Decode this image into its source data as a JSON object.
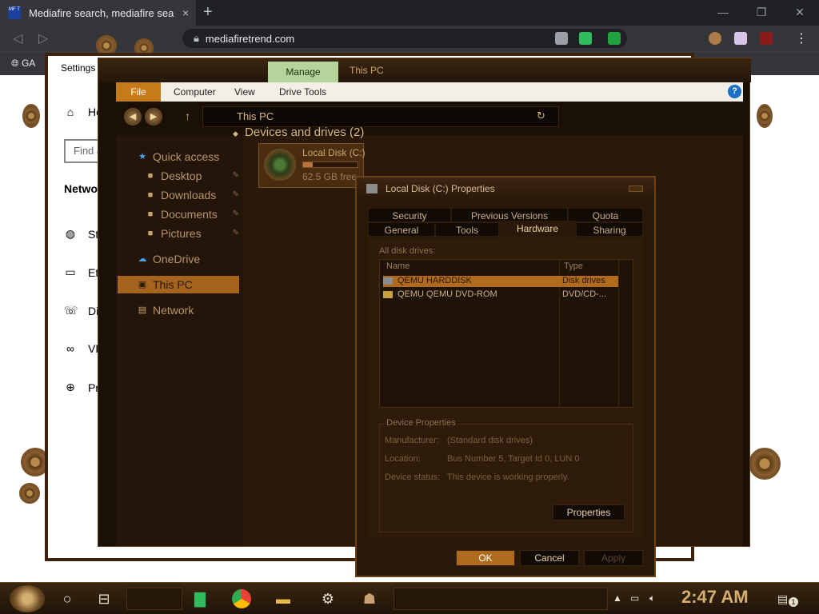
{
  "browser": {
    "tab_title": "Mediafire search, mediafire sea",
    "favicon_text": "MF T",
    "url": "mediafiretrend.com",
    "bookmark": "GA",
    "new_tab": "+",
    "tab_close": "×",
    "win_controls": [
      "—",
      "❐",
      "✕"
    ]
  },
  "settings": {
    "title": "Settings",
    "nav": [
      {
        "label": "Ho",
        "icon": "home-icon",
        "glyph": "⌂"
      },
      {
        "label": "Sta",
        "icon": "globe-icon",
        "glyph": "◍"
      },
      {
        "label": "Eth",
        "icon": "ethernet-icon",
        "glyph": "▭"
      },
      {
        "label": "Dia",
        "icon": "dialup-icon",
        "glyph": "☏"
      },
      {
        "label": "VPN",
        "icon": "vpn-icon",
        "glyph": "∞"
      },
      {
        "label": "Pro",
        "icon": "proxy-icon",
        "glyph": "⊕"
      }
    ],
    "search_placeholder": "Find a",
    "heading": "Netwo"
  },
  "explorer": {
    "manage_tab": "Manage",
    "title": "This PC",
    "ribbon_tabs": [
      "File",
      "Computer",
      "View",
      "Drive Tools"
    ],
    "address": "This PC",
    "nav": {
      "quick_access": "Quick access",
      "desktop": "Desktop",
      "downloads": "Downloads",
      "documents": "Documents",
      "pictures": "Pictures",
      "onedrive": "OneDrive",
      "this_pc": "This PC",
      "network": "Network"
    },
    "section_title": "Devices and drives (2)",
    "drive": {
      "name": "Local Disk (C:)",
      "free": "62.5 GB free",
      "used_fraction": 0.18
    }
  },
  "properties": {
    "title": "Local Disk (C:) Properties",
    "tabs_row1": [
      "Security",
      "Previous Versions",
      "Quota"
    ],
    "tabs_row2": [
      "General",
      "Tools",
      "Hardware",
      "Sharing"
    ],
    "panel_label": "All disk drives:",
    "columns": [
      "Name",
      "Type"
    ],
    "rows": [
      {
        "name": "QEMU HARDDISK",
        "type": "Disk drives"
      },
      {
        "name": "QEMU QEMU DVD-ROM",
        "type": "DVD/CD-..."
      }
    ],
    "device_props_title": "Device Properties",
    "manufacturer_label": "Manufacturer:",
    "manufacturer": "(Standard disk drives)",
    "location_label": "Location:",
    "location": "Bus Number 5, Target Id 0, LUN 0",
    "status_label": "Device status:",
    "status": "This device is working properly.",
    "properties_button": "Properties",
    "ok": "OK",
    "cancel": "Cancel",
    "apply": "Apply"
  },
  "taskbar": {
    "clock": "2:47 AM",
    "notification_count": "1"
  },
  "colors": {
    "accent": "#b06a1e",
    "manage_green": "#b5d49b",
    "help_blue": "#1b6fc5"
  }
}
